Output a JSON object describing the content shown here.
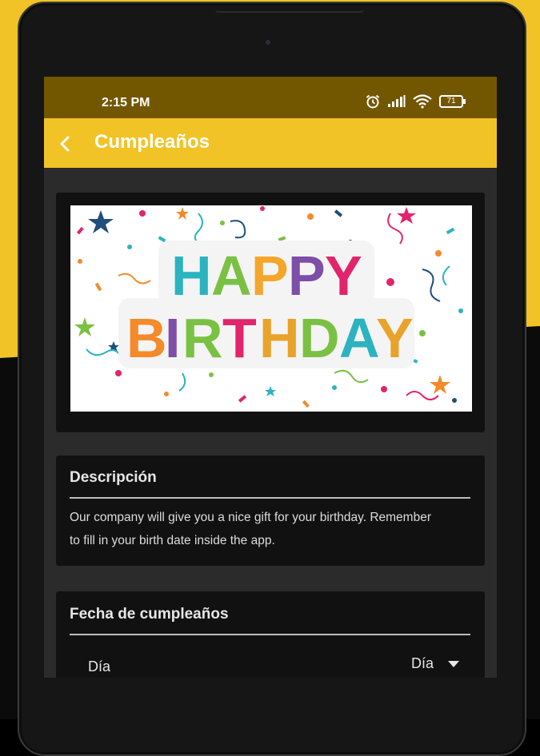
{
  "status_bar": {
    "time": "2:15 PM",
    "battery": "71",
    "icons": [
      "alarm-icon",
      "signal-icon",
      "wifi-icon",
      "battery-icon"
    ]
  },
  "app_bar": {
    "title": "Cumpleaños",
    "back_icon": "chevron-left-icon"
  },
  "banner": {
    "line1_letters": [
      "H",
      "A",
      "P",
      "P",
      "Y"
    ],
    "line2_letters": [
      "B",
      "I",
      "R",
      "T",
      "H",
      "D",
      "A",
      "Y"
    ]
  },
  "description": {
    "title": "Descripción",
    "line1": "Our company will give you a nice gift for your birthday. Remember",
    "line2": "to fill in your birth date inside the app."
  },
  "birthday": {
    "title": "Fecha de cumpleaños",
    "day_label": "Día",
    "day_selected": "Día"
  },
  "colors": {
    "accent": "#f1c327",
    "status_bar": "#735700",
    "card": "#111111",
    "screen_bg": "#2b2b2b"
  }
}
